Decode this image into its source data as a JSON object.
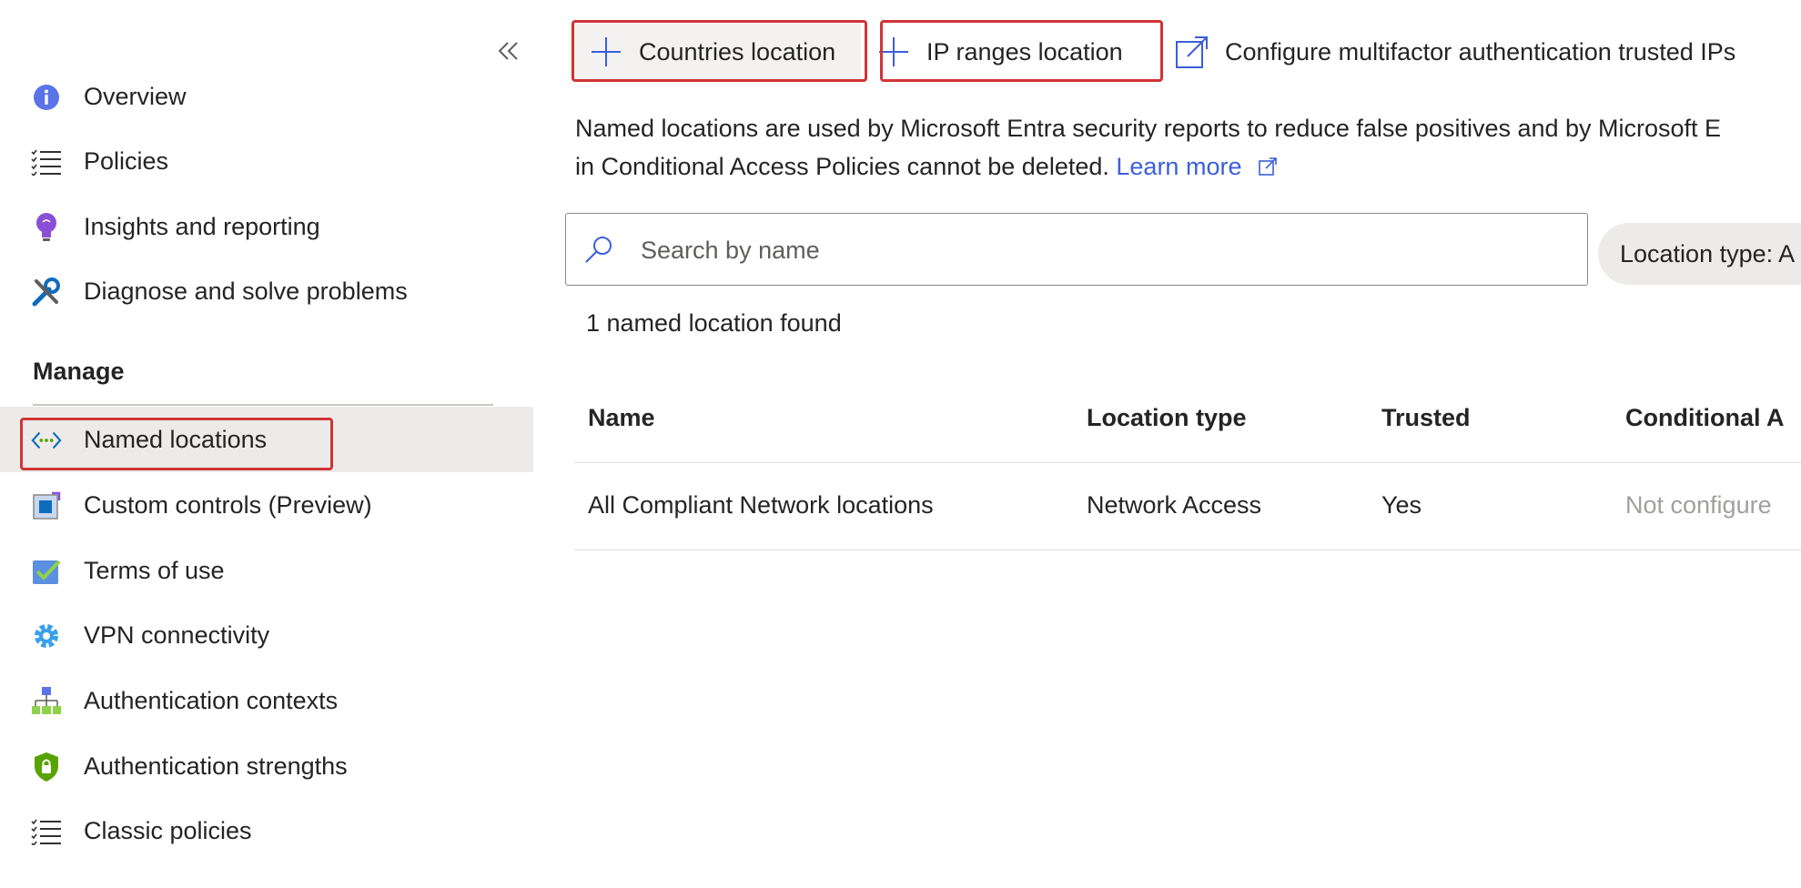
{
  "sidebar": {
    "collapse_label": "«",
    "items": [
      {
        "label": "Overview",
        "icon": "info-icon"
      },
      {
        "label": "Policies",
        "icon": "list-icon"
      },
      {
        "label": "Insights and reporting",
        "icon": "lightbulb-icon"
      },
      {
        "label": "Diagnose and solve problems",
        "icon": "wrench-icon"
      }
    ],
    "section_header": "Manage",
    "manage_items": [
      {
        "label": "Named locations",
        "icon": "named-locations-icon",
        "selected": true
      },
      {
        "label": "Custom controls (Preview)",
        "icon": "custom-controls-icon"
      },
      {
        "label": "Terms of use",
        "icon": "checkmark-icon"
      },
      {
        "label": "VPN connectivity",
        "icon": "gear-icon"
      },
      {
        "label": "Authentication contexts",
        "icon": "hierarchy-icon"
      },
      {
        "label": "Authentication strengths",
        "icon": "shield-lock-icon"
      },
      {
        "label": "Classic policies",
        "icon": "list-icon"
      }
    ]
  },
  "toolbar": {
    "countries_label": "Countries location",
    "ip_ranges_label": "IP ranges location",
    "mfa_label": "Configure multifactor authentication trusted IPs"
  },
  "description": {
    "line1": "Named locations are used by Microsoft Entra security reports to reduce false positives and by Microsoft E",
    "line2": "in Conditional Access Policies cannot be deleted.",
    "learn_more": "Learn more"
  },
  "search": {
    "placeholder": "Search by name"
  },
  "filter": {
    "label": "Location type: A"
  },
  "results_count": "1 named location found",
  "table": {
    "headers": [
      "Name",
      "Location type",
      "Trusted",
      "Conditional A"
    ],
    "rows": [
      {
        "name": "All Compliant Network locations",
        "location_type": "Network Access",
        "trusted": "Yes",
        "conditional_access": "Not configure"
      }
    ]
  },
  "colors": {
    "accent": "#3b5fd9",
    "highlight_border": "#d13438",
    "selected_bg": "#edebe9"
  }
}
